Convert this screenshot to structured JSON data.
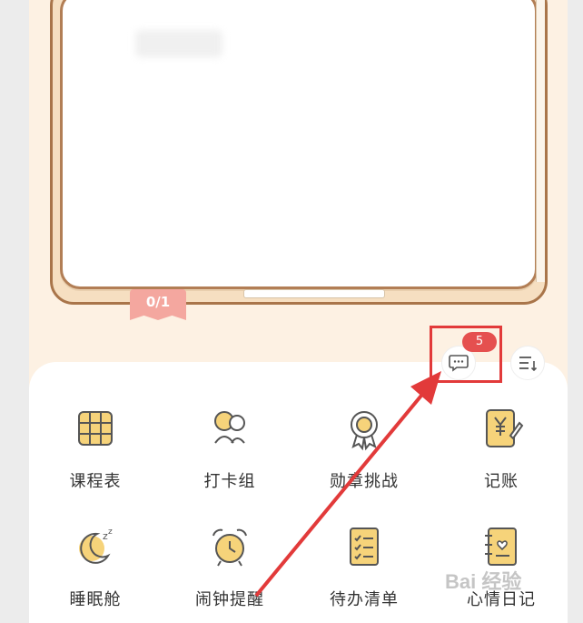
{
  "page_counter": "0/1",
  "toolbar": {
    "chat_badge_count": "5"
  },
  "features": [
    {
      "label": "课程表",
      "icon": "timetable-icon"
    },
    {
      "label": "打卡组",
      "icon": "checkin-group-icon"
    },
    {
      "label": "勋章挑战",
      "icon": "medal-challenge-icon"
    },
    {
      "label": "记账",
      "icon": "accounting-icon"
    },
    {
      "label": "睡眠舱",
      "icon": "sleep-pod-icon"
    },
    {
      "label": "闹钟提醒",
      "icon": "alarm-clock-icon"
    },
    {
      "label": "待办清单",
      "icon": "todo-list-icon"
    },
    {
      "label": "心情日记",
      "icon": "mood-diary-icon"
    }
  ],
  "watermark": "Bai 经验",
  "colors": {
    "accent_red": "#e23a3a",
    "badge_red": "#e5504f",
    "counter_pink": "#f4a79f",
    "icon_yellow": "#f6d37a",
    "icon_stroke": "#555555"
  }
}
